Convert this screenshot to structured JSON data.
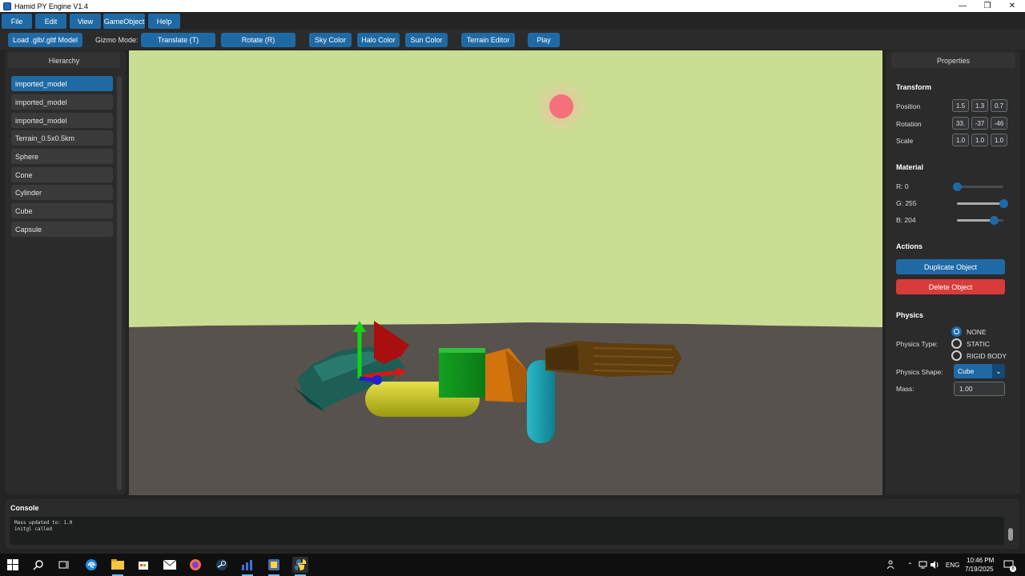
{
  "window": {
    "title": "Hamid PY Engine V1.4",
    "minimize": "—",
    "maximize": "❐",
    "close": "✕"
  },
  "menu": {
    "items": [
      "File",
      "Edit",
      "View",
      "GameObject",
      "Help"
    ]
  },
  "toolbar": {
    "load_model": "Load .glb/.gltf Model",
    "gizmo_label": "Gizmo Mode:",
    "translate": "Translate (T)",
    "rotate": "Rotate (R)",
    "sky_color": "Sky Color",
    "halo_color": "Halo Color",
    "sun_color": "Sun Color",
    "terrain_editor": "Terrain Editor",
    "play": "Play"
  },
  "hierarchy": {
    "title": "Hierarchy",
    "items": [
      "imported_model",
      "imported_model",
      "imported_model",
      "Terrain_0.5x0.5km",
      "Sphere",
      "Cone",
      "Cylinder",
      "Cube",
      "Capsule"
    ],
    "selected_index": 0
  },
  "viewport": {
    "sky_color": "#c9de92",
    "ground_color": "#57524d",
    "sun_color": "#f4707a"
  },
  "properties": {
    "title": "Properties",
    "transform": {
      "heading": "Transform",
      "position_label": "Position",
      "rotation_label": "Rotation",
      "scale_label": "Scale",
      "position": [
        "1.5",
        "1.3",
        "0.7"
      ],
      "rotation": [
        "33.",
        "-37",
        "-46"
      ],
      "scale": [
        "1.0",
        "1.0",
        "1.0"
      ]
    },
    "material": {
      "heading": "Material",
      "r_label": "R: 0",
      "g_label": "G: 255",
      "b_label": "B: 204",
      "r": 0,
      "g": 255,
      "b": 204
    },
    "actions": {
      "heading": "Actions",
      "duplicate": "Duplicate Object",
      "delete": "Delete Object",
      "duplicate_color": "#1f6aa5",
      "delete_color": "#d93a3a"
    },
    "physics": {
      "heading": "Physics",
      "type_label": "Physics Type:",
      "options": [
        "NONE",
        "STATIC",
        "RIGID BODY"
      ],
      "selected": "NONE",
      "shape_label": "Physics Shape:",
      "shape": "Cube",
      "mass_label": "Mass:",
      "mass": "1.00"
    }
  },
  "console": {
    "title": "Console",
    "lines": [
      "Mass updated to: 1.0",
      "initgl called"
    ]
  },
  "taskbar": {
    "language": "ENG",
    "time": "10:46 PM",
    "date": "7/19/2025",
    "notification_count": "8"
  }
}
